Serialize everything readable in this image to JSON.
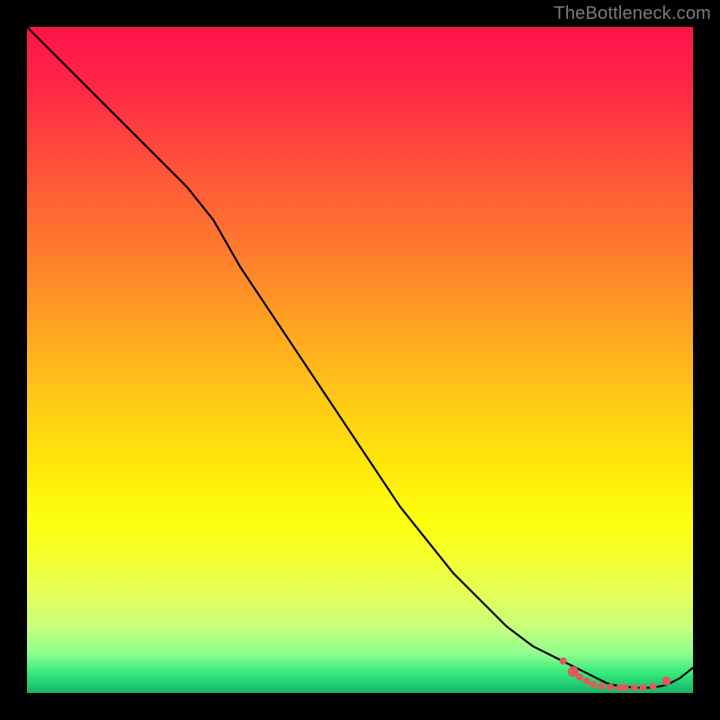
{
  "watermark": "TheBottleneck.com",
  "chart_data": {
    "type": "line",
    "title": "",
    "xlabel": "",
    "ylabel": "",
    "xlim": [
      0,
      100
    ],
    "ylim": [
      0,
      100
    ],
    "series": [
      {
        "name": "curve",
        "x": [
          0,
          4,
          8,
          12,
          16,
          20,
          24,
          28,
          32,
          36,
          40,
          44,
          48,
          52,
          56,
          60,
          64,
          68,
          72,
          76,
          80,
          84,
          87,
          88,
          90,
          92,
          94,
          96,
          98,
          100
        ],
        "y": [
          100,
          96,
          92,
          88,
          84,
          80,
          76,
          71,
          64,
          58,
          52,
          46,
          40,
          34,
          28,
          23,
          18,
          14,
          10,
          7,
          5,
          3,
          1.5,
          1.2,
          0.9,
          0.8,
          0.8,
          1.2,
          2.2,
          3.8
        ]
      }
    ],
    "markers": [
      {
        "x": 80.5,
        "y": 4.8,
        "r": 4
      },
      {
        "x": 82.0,
        "y": 3.2,
        "r": 6
      },
      {
        "x": 83.0,
        "y": 2.4,
        "r": 4
      },
      {
        "x": 84.0,
        "y": 1.8,
        "r": 4
      },
      {
        "x": 85.0,
        "y": 1.3,
        "r": 4
      },
      {
        "x": 86.2,
        "y": 1.0,
        "r": 4
      },
      {
        "x": 87.6,
        "y": 0.9,
        "r": 4
      },
      {
        "x": 89.0,
        "y": 0.8,
        "r": 4
      },
      {
        "x": 89.8,
        "y": 0.8,
        "r": 4
      },
      {
        "x": 91.2,
        "y": 0.8,
        "r": 4
      },
      {
        "x": 92.5,
        "y": 0.8,
        "r": 4
      },
      {
        "x": 94.0,
        "y": 1.0,
        "r": 4
      },
      {
        "x": 96.0,
        "y": 1.8,
        "r": 5
      }
    ],
    "marker_color": "#e05a5a",
    "line_color": "#000000"
  }
}
